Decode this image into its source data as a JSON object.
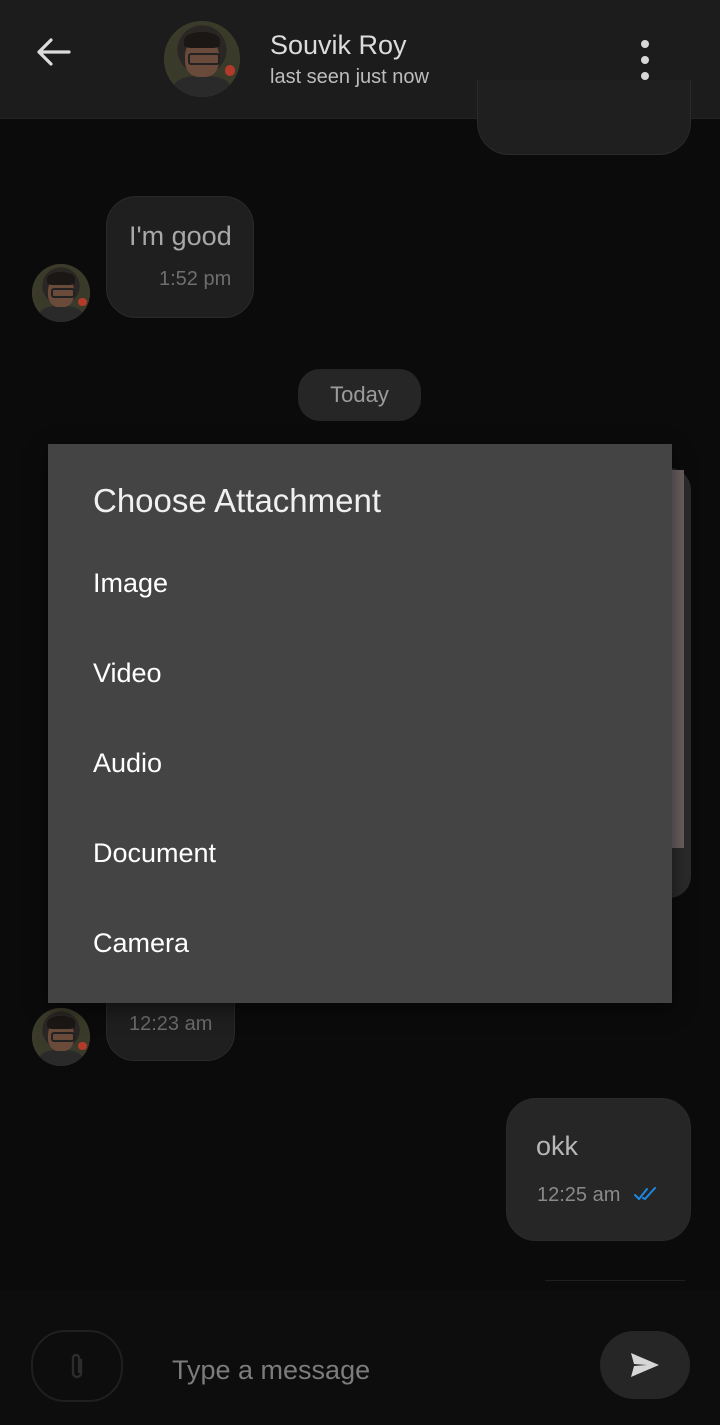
{
  "header": {
    "contact_name": "Souvik Roy",
    "last_seen": "last seen just now",
    "icons": {
      "back": "arrow-left-icon",
      "menu": "more-vertical-icon"
    }
  },
  "messages": {
    "received_1": {
      "text": "I'm good",
      "time": "1:52 pm"
    },
    "received_2": {
      "time": "12:23 am"
    },
    "sent_1": {
      "text": "okk",
      "time": "12:25 am",
      "status_icon": "double-check-icon",
      "status_color": "#1e88e5"
    }
  },
  "date_chip": "Today",
  "dialog": {
    "title": "Choose Attachment",
    "options": [
      "Image",
      "Video",
      "Audio",
      "Document",
      "Camera"
    ]
  },
  "composer": {
    "placeholder": "Type a message",
    "icons": {
      "attach": "paperclip-icon",
      "send": "send-icon"
    }
  },
  "colors": {
    "background": "#0b0b0b",
    "header": "#1c1c1c",
    "dialog": "#444444",
    "bubble": "#1f1f1f"
  }
}
